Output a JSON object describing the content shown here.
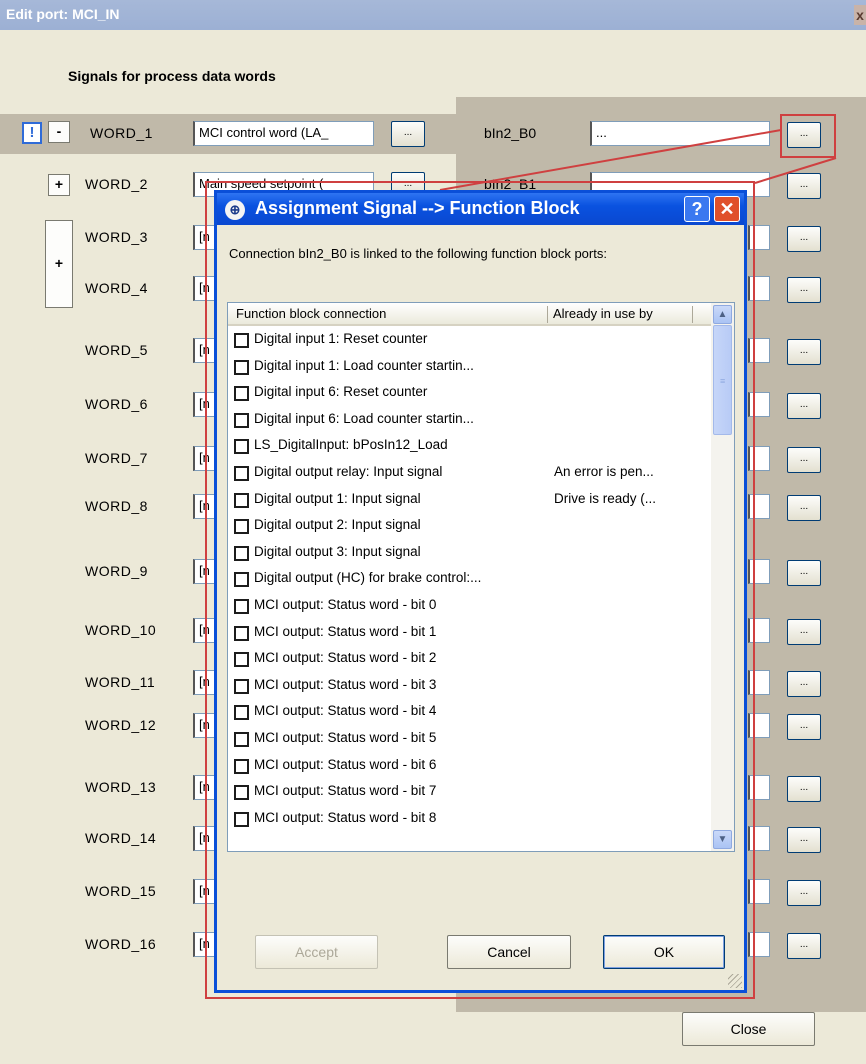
{
  "window": {
    "title": "Edit port: MCI_IN",
    "close_glyph": "x",
    "heading": "Signals for process data words",
    "close_button": "Close"
  },
  "warning_icon": "exclamation-icon",
  "words": [
    {
      "label": "WORD_1",
      "toggle": "-",
      "value": "MCI control word (LA_"
    },
    {
      "label": "WORD_2",
      "toggle": "+",
      "value": "Main speed setpoint ("
    },
    {
      "label": "WORD_3",
      "toggle": "+",
      "value": "[n"
    },
    {
      "label": "WORD_4",
      "value": "[n"
    },
    {
      "label": "WORD_5",
      "value": "[n"
    },
    {
      "label": "WORD_6",
      "value": "[n"
    },
    {
      "label": "WORD_7",
      "value": "[n"
    },
    {
      "label": "WORD_8",
      "value": "[n"
    },
    {
      "label": "WORD_9",
      "value": "[n"
    },
    {
      "label": "WORD_10",
      "value": "[n"
    },
    {
      "label": "WORD_11",
      "value": "[n"
    },
    {
      "label": "WORD_12",
      "value": "[n"
    },
    {
      "label": "WORD_13",
      "value": "[n"
    },
    {
      "label": "WORD_14",
      "value": "[n"
    },
    {
      "label": "WORD_15",
      "value": "[n"
    },
    {
      "label": "WORD_16",
      "value": "[n"
    }
  ],
  "ellipsis": "...",
  "bits": [
    {
      "label": "bIn2_B0",
      "value": "..."
    },
    {
      "label": "bIn2_B1",
      "value": ""
    }
  ],
  "dialog": {
    "title": "Assignment Signal --> Function Block",
    "help_glyph": "?",
    "close_glyph": "✕",
    "message": "Connection bIn2_B0 is linked to the following function block ports:",
    "columns": [
      "Function block connection",
      "Already in use by"
    ],
    "rows": [
      {
        "text": "Digital input 1: Reset counter",
        "in_use": ""
      },
      {
        "text": "Digital input 1: Load counter startin...",
        "in_use": ""
      },
      {
        "text": "Digital input 6: Reset counter",
        "in_use": ""
      },
      {
        "text": "Digital input 6: Load counter startin...",
        "in_use": ""
      },
      {
        "text": "LS_DigitalInput: bPosIn12_Load",
        "in_use": ""
      },
      {
        "text": "Digital output relay: Input signal",
        "in_use": "An error is pen..."
      },
      {
        "text": "Digital output 1: Input signal",
        "in_use": "Drive is ready (..."
      },
      {
        "text": "Digital output 2: Input signal",
        "in_use": ""
      },
      {
        "text": "Digital output 3: Input signal",
        "in_use": ""
      },
      {
        "text": "Digital output (HC) for brake control:...",
        "in_use": ""
      },
      {
        "text": "MCI output: Status word - bit 0",
        "in_use": ""
      },
      {
        "text": "MCI output: Status word - bit 1",
        "in_use": ""
      },
      {
        "text": "MCI output: Status word - bit 2",
        "in_use": ""
      },
      {
        "text": "MCI output: Status word - bit 3",
        "in_use": ""
      },
      {
        "text": "MCI output: Status word - bit 4",
        "in_use": ""
      },
      {
        "text": "MCI output: Status word - bit 5",
        "in_use": ""
      },
      {
        "text": "MCI output: Status word - bit 6",
        "in_use": ""
      },
      {
        "text": "MCI output: Status word - bit 7",
        "in_use": ""
      },
      {
        "text": "MCI output: Status word - bit 8",
        "in_use": ""
      }
    ],
    "scroll_up": "▲",
    "scroll_down": "▼",
    "grip": "≡",
    "buttons": {
      "accept": "Accept",
      "cancel": "Cancel",
      "ok": "OK"
    }
  },
  "colors": {
    "dialog_blue": "#0a4fd8",
    "highlight_red": "#cf4040"
  }
}
